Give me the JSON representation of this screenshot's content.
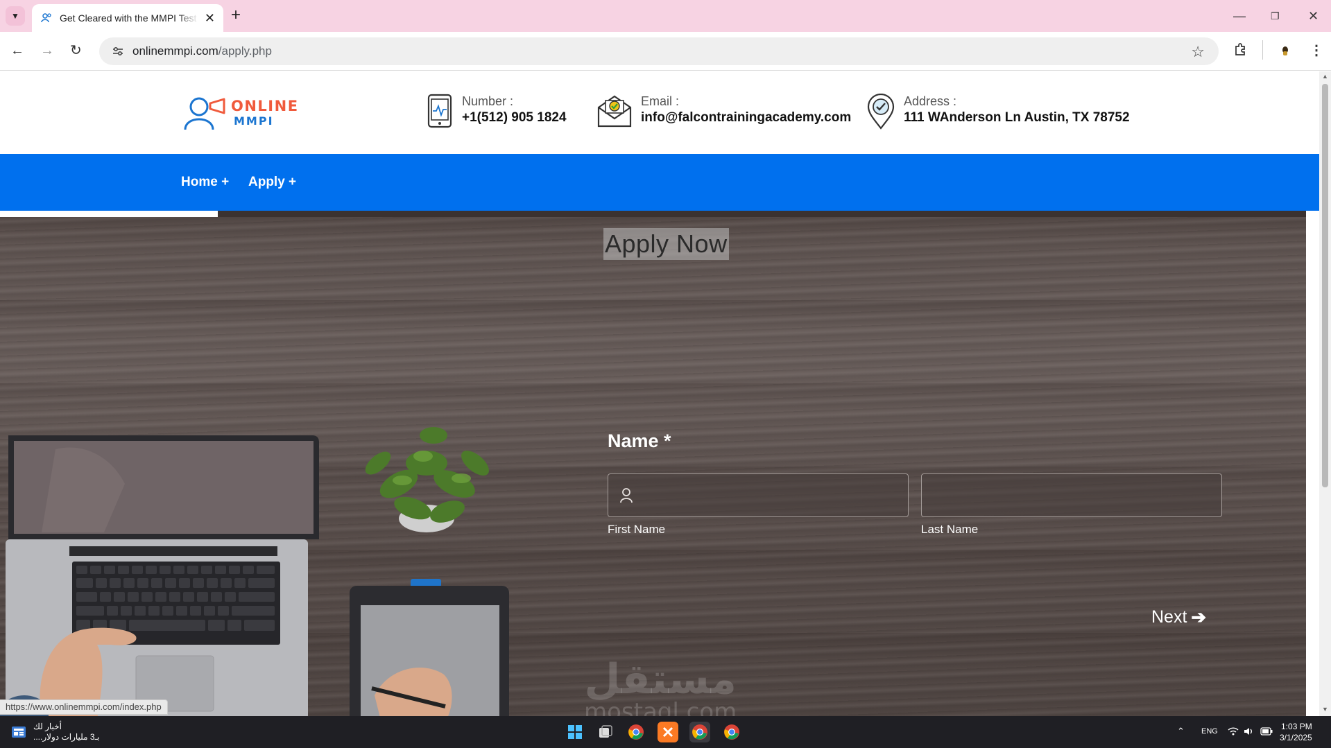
{
  "browser": {
    "tab_title": "Get Cleared with the MMPI Test",
    "url_host": "onlinemmpi.com",
    "url_path": "/apply.php",
    "status_url": "https://www.onlinemmpi.com/index.php"
  },
  "header": {
    "logo_line1": "ONLINE",
    "logo_line2": "MMPI",
    "number_label": "Number :",
    "number_value": "+1(512) 905 1824",
    "email_label": "Email :",
    "email_value": "info@falcontrainingacademy.com",
    "address_label": "Address :",
    "address_value": "111 WAnderson Ln Austin, TX 78752"
  },
  "nav": {
    "home": "Home +",
    "apply": "Apply +"
  },
  "form": {
    "progress_fraction": 0.167,
    "title": "Apply Now",
    "name_label": "Name *",
    "first_name_label": "First Name",
    "last_name_label": "Last Name",
    "next_label": "Next"
  },
  "watermark": {
    "arabic": "مستقل",
    "latin": "mostaql.com"
  },
  "taskbar": {
    "news_title": "أخبار لك",
    "news_sub": "بـ3 مليارات دولار....",
    "lang": "ENG",
    "time": "1:03 PM",
    "date": "3/1/2025"
  },
  "colors": {
    "nav_blue": "#0070ee",
    "logo_orange": "#f05a3c",
    "logo_blue": "#1b75d0",
    "tab_strip": "#f7d3e3"
  }
}
